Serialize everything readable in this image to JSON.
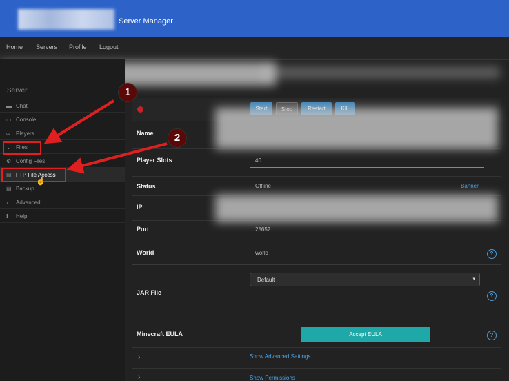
{
  "header": {
    "app_title": "Server Manager"
  },
  "nav": {
    "items": [
      "Home",
      "Servers",
      "Profile",
      "Logout"
    ]
  },
  "sidebar": {
    "heading": "Server",
    "items": [
      {
        "label": "Chat",
        "icon": "chat-icon",
        "glyph": "▬"
      },
      {
        "label": "Console",
        "icon": "console-icon",
        "glyph": "▭"
      },
      {
        "label": "Players",
        "icon": "players-icon",
        "glyph": "∞"
      },
      {
        "label": "Files",
        "icon": "chevron-down-icon",
        "glyph": "⌄"
      },
      {
        "label": "Config Files",
        "icon": "gear-icon",
        "glyph": "⚙"
      },
      {
        "label": "FTP File Access",
        "icon": "file-icon",
        "glyph": "▤"
      },
      {
        "label": "Backup",
        "icon": "backup-icon",
        "glyph": "▤"
      },
      {
        "label": "Advanced",
        "icon": "chevron-right-icon",
        "glyph": "›"
      },
      {
        "label": "Help",
        "icon": "info-icon",
        "glyph": "ℹ"
      }
    ]
  },
  "controls": {
    "start": "Start",
    "stop": "Stop",
    "restart": "Restart",
    "kill": "Kill",
    "status_color": "#c0242a"
  },
  "form": {
    "name_label": "Name",
    "slots_label": "Player Slots",
    "slots_value": "40",
    "status_label": "Status",
    "status_value": "Offline",
    "banner_link": "Banner",
    "ip_label": "IP",
    "port_label": "Port",
    "port_value": "25652",
    "world_label": "World",
    "world_value": "world",
    "jar_label": "JAR File",
    "jar_value": "Default",
    "eula_label": "Minecraft EULA",
    "eula_button": "Accept EULA",
    "advanced_link": "Show Advanced Settings",
    "permissions_link": "Show Permissions",
    "help_glyph": "?"
  },
  "annotations": {
    "callout_1": "1",
    "callout_2": "2",
    "color": "#e02020"
  }
}
